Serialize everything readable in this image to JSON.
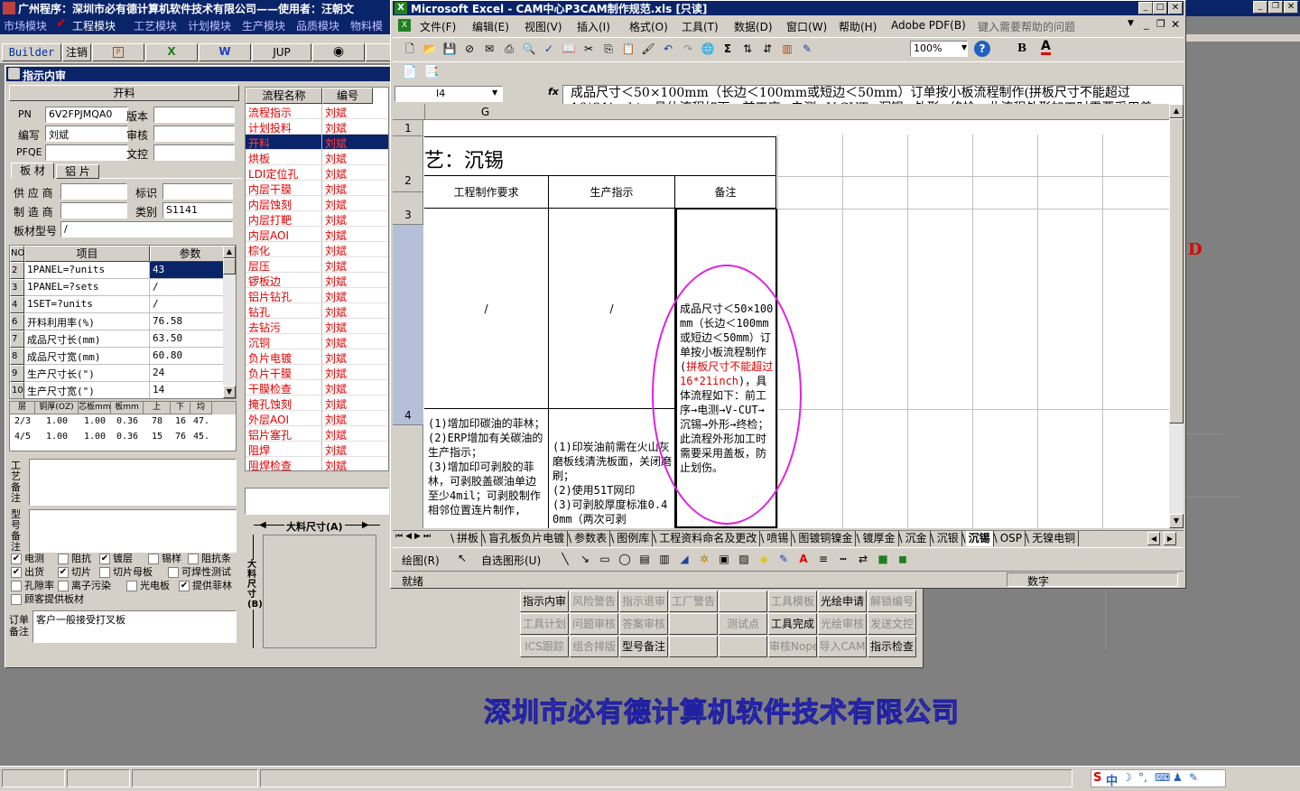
{
  "app": {
    "title": "广州程序：深圳市必有德计算机软件技术有限公司——使用者：汪朝文",
    "menus": [
      "市场模块",
      "工程模块",
      "工艺模块",
      "计划模块",
      "生产模块",
      "品质模块",
      "物料模块"
    ],
    "checked_menu": "工程模块"
  },
  "toolbar": {
    "builder": "Builder",
    "logout": "注销",
    "jup": "JUP"
  },
  "panel": {
    "title": "指示内审",
    "section": "开料",
    "pn_label": "PN",
    "pn": "6V2FPJMQA0",
    "version_label": "版本",
    "version": "",
    "editor_label": "编写",
    "editor": "刘斌",
    "review_label": "审核",
    "review": "",
    "pfqe_label": "PFQE",
    "pfqe": "",
    "doc_label": "文控",
    "doc": ""
  },
  "tabs": [
    "板 材",
    "铝 片"
  ],
  "material": {
    "supplier_label": "供 应 商",
    "supplier": "",
    "mark_label": "标识",
    "mark": "",
    "maker_label": "制 造 商",
    "maker": "",
    "type_label": "类别",
    "type": "S1141",
    "model_label": "板材型号",
    "model": "/"
  },
  "params": {
    "headers": [
      "NO",
      "项目",
      "参数"
    ],
    "rows": [
      {
        "no": "2",
        "item": "1PANEL=?units",
        "val": "43"
      },
      {
        "no": "3",
        "item": "1PANEL=?sets",
        "val": "/"
      },
      {
        "no": "4",
        "item": "1SET=?units",
        "val": "/"
      },
      {
        "no": "6",
        "item": "开料利用率(%)",
        "val": "76.58"
      },
      {
        "no": "7",
        "item": "成品尺寸长(mm)",
        "val": "63.50"
      },
      {
        "no": "8",
        "item": "成品尺寸宽(mm)",
        "val": "60.80"
      },
      {
        "no": "9",
        "item": "生产尺寸长(\")",
        "val": "24"
      },
      {
        "no": "10",
        "item": "生产尺寸宽(\")",
        "val": "14"
      }
    ]
  },
  "layers": {
    "headers": [
      "层",
      "铜厚(OZ)",
      "芯板mm",
      "板mm",
      "上",
      "下",
      "均"
    ],
    "rows": [
      [
        "2/3",
        "1.00",
        "1.00",
        "0.36",
        "78",
        "16",
        "47."
      ],
      [
        "4/5",
        "1.00",
        "1.00",
        "0.36",
        "15",
        "76",
        "45."
      ]
    ]
  },
  "notes": {
    "craft_label": "工艺备注",
    "model_label": "型号备注",
    "order_label": "订单备注",
    "order_text": "客户一般接受打叉板"
  },
  "checks": [
    {
      "label": "电测",
      "checked": true
    },
    {
      "label": "阻抗",
      "checked": false
    },
    {
      "label": "镀层",
      "checked": true
    },
    {
      "label": "锡样",
      "checked": false
    },
    {
      "label": "阻抗条",
      "checked": false
    },
    {
      "label": "出货",
      "checked": true
    },
    {
      "label": "切片",
      "checked": true
    },
    {
      "label": "切片母板",
      "checked": false
    },
    {
      "label": "可焊性测试",
      "checked": false
    },
    {
      "label": "孔隙率",
      "checked": false
    },
    {
      "label": "离子污染",
      "checked": false
    },
    {
      "label": "光电板",
      "checked": false
    },
    {
      "label": "提供菲林",
      "checked": true
    },
    {
      "label": "顾客提供板材",
      "checked": false
    }
  ],
  "flow": {
    "headers": [
      "流程名称",
      "编号"
    ],
    "rows": [
      [
        "流程指示",
        "刘斌"
      ],
      [
        "计划投料",
        "刘斌"
      ],
      [
        "开料",
        "刘斌"
      ],
      [
        "烘板",
        "刘斌"
      ],
      [
        "LDI定位孔",
        "刘斌"
      ],
      [
        "内层干膜",
        "刘斌"
      ],
      [
        "内层蚀刻",
        "刘斌"
      ],
      [
        "内层打靶",
        "刘斌"
      ],
      [
        "内层AOI",
        "刘斌"
      ],
      [
        "棕化",
        "刘斌"
      ],
      [
        "层压",
        "刘斌"
      ],
      [
        "锣板边",
        "刘斌"
      ],
      [
        "铝片钻孔",
        "刘斌"
      ],
      [
        "钻孔",
        "刘斌"
      ],
      [
        "去钻污",
        "刘斌"
      ],
      [
        "沉铜",
        "刘斌"
      ],
      [
        "负片电镀",
        "刘斌"
      ],
      [
        "负片干膜",
        "刘斌"
      ],
      [
        "干膜检查",
        "刘斌"
      ],
      [
        "掩孔蚀刻",
        "刘斌"
      ],
      [
        "外层AOI",
        "刘斌"
      ],
      [
        "铝片塞孔",
        "刘斌"
      ],
      [
        "阻焊",
        "刘斌"
      ],
      [
        "阻焊检查",
        "刘斌"
      ]
    ],
    "selected": 2
  },
  "dimension": {
    "a": "大料尺寸(A)",
    "b": "大料尺寸(B)"
  },
  "buttons": [
    {
      "label": "指示内审",
      "dis": false
    },
    {
      "label": "风险警告",
      "dis": true
    },
    {
      "label": "指示退审",
      "dis": true
    },
    {
      "label": "工厂警告",
      "dis": true
    },
    {
      "label": "",
      "dis": true
    },
    {
      "label": "工具模板",
      "dis": true
    },
    {
      "label": "光绘申请",
      "dis": false
    },
    {
      "label": "解锁编号",
      "dis": true
    },
    {
      "label": "工具计划",
      "dis": true
    },
    {
      "label": "问题审核",
      "dis": true
    },
    {
      "label": "答案审核",
      "dis": true
    },
    {
      "label": "",
      "dis": true
    },
    {
      "label": "测试点",
      "dis": true
    },
    {
      "label": "工具完成",
      "dis": false
    },
    {
      "label": "光绘审核",
      "dis": true
    },
    {
      "label": "发送文控",
      "dis": true
    },
    {
      "label": "ICS跟踪",
      "dis": true
    },
    {
      "label": "组合排版",
      "dis": true
    },
    {
      "label": "型号备注",
      "dis": false
    },
    {
      "label": "",
      "dis": true
    },
    {
      "label": "",
      "dis": true
    },
    {
      "label": "审核Nope",
      "dis": true
    },
    {
      "label": "导入CAM",
      "dis": true
    },
    {
      "label": "指示检查",
      "dis": false
    }
  ],
  "company": "深圳市必有德计算机软件技术有限公司",
  "stray": "D",
  "excel": {
    "title": "Microsoft Excel - CAM中心P3CAM制作规范.xls [只读]",
    "menus": [
      "文件(F)",
      "编辑(E)",
      "视图(V)",
      "插入(I)",
      "格式(O)",
      "工具(T)",
      "数据(D)",
      "窗口(W)",
      "帮助(H)",
      "Adobe PDF(B)"
    ],
    "help_placeholder": "键入需要帮助的问题",
    "zoom": "100%",
    "bold": "B",
    "namebox": "I4",
    "fx": "fx",
    "formula": "成品尺寸＜50×100mm（长边＜100mm或短边＜50mm）订单按小板流程制作(拼板尺寸不能超过16*21inch)，具体流程如下：前工序→电测→V-CUT→沉锡→外形→终检；此流程外形加工时需要采用盖板，防止划伤。",
    "col": "G",
    "rows": [
      "1",
      "2",
      "3",
      "4"
    ],
    "sheet_title": "艺：沉锡",
    "headers": [
      "工程制作要求",
      "生产指示",
      "备注"
    ],
    "slash1": "/",
    "slash2": "/",
    "note_pre": "成品尺寸＜50×100mm（长边＜100mm或短边＜50mm）订单按小板流程制作(",
    "note_red": "拼板尺寸不能超过16*21inch",
    "note_post": ")，具体流程如下：前工序→电测→V-CUT→沉锡→外形→终检；此流程外形加工时需要采用盖板，防止划伤。",
    "req_text": "(1)增加印碳油的菲林；\n(2)ERP增加有关碳油的生产指示；\n(3)增加印可剥胶的菲林，可剥胶盖碳油单边至少4mil；可剥胶制作相邻位置连片制作,",
    "prod_text": "(1)印炭油前需在火山灰磨板线清洗板面，关闭磨刷；\n(2)使用51T网印\n(3)可剥胶厚度标准0.40mm（两次可剥",
    "tabs": [
      "拼板",
      "盲孔板负片电镀",
      "参数表",
      "图例库",
      "工程资料命名及更改",
      "喷锡",
      "图镀铜镍金",
      "镀厚金",
      "沉金",
      "沉银",
      "沉锡",
      "OSP",
      "无镍电铜"
    ],
    "active_tab": "沉锡",
    "draw_label": "绘图(R)",
    "autoshape_label": "自选图形(U)",
    "status_ready": "就绪",
    "status_num": "数字"
  },
  "ime": {
    "label": "中"
  },
  "colors": {
    "highlight": "#0a246a",
    "annotation": "#e020e0",
    "titlebar": "#0a246a"
  }
}
